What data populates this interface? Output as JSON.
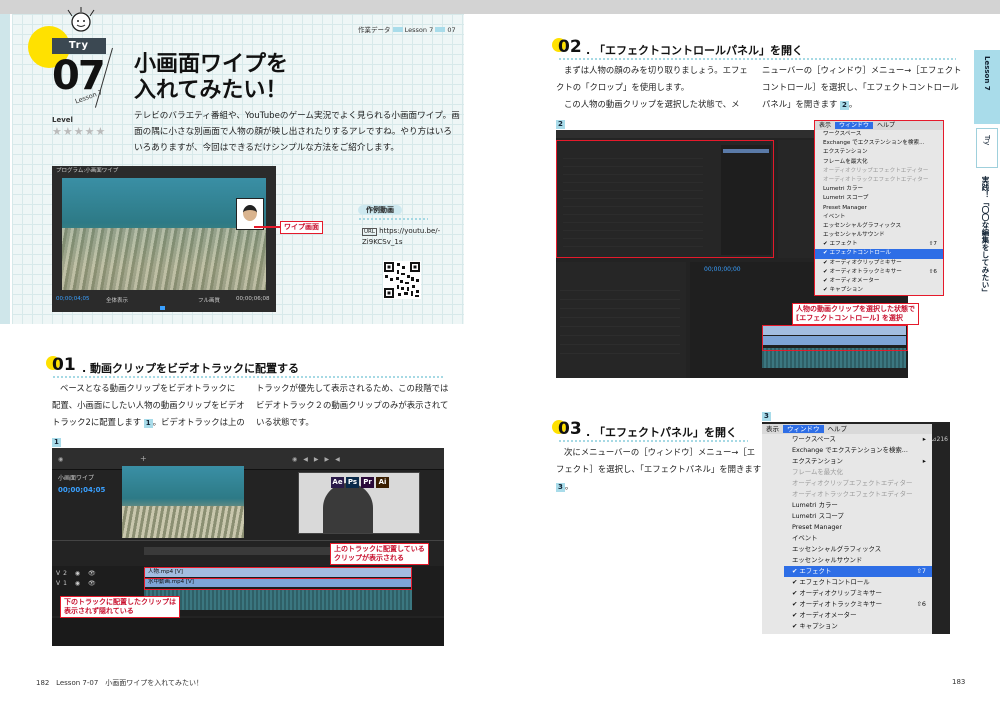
{
  "header": {
    "breadcrumb": [
      "作業データ",
      "Lesson 7",
      "07"
    ]
  },
  "lesson": {
    "try_label": "Try",
    "number": "07",
    "lesson_label": "Lesson 7",
    "title_line1": "小画面ワイプを",
    "title_line2": "入れてみたい！",
    "level_label": "Level",
    "level_stars": 5,
    "intro_lines": [
      "テレビのバラエティ番組や、YouTubeのゲーム実況でよく見られる小画面ワイプ。画",
      "面の隅に小さな別画面で人物の顔が映し出されたりするアレですね。やり方はいろ",
      "いろありますが、今回はできるだけシンプルな方法をご紹介します。"
    ]
  },
  "program_monitor": {
    "title": "プログラム:小画面ワイプ",
    "timecode_left": "00;00;04;05",
    "fit": "全体表示",
    "quality": "フル画質",
    "timecode_right": "00;00;06;08",
    "wipe_label": "ワイプ画面"
  },
  "video_link": {
    "heading": "作例動画",
    "url_tag": "URL",
    "url_line1": "https://youtu.be/-",
    "url_line2": "Zi9KCSv_1s"
  },
  "step01": {
    "num": "01",
    "title": "動画クリップをビデオトラックに配置する",
    "col1": [
      "ベースとなる動画クリップをビデオトラックに",
      "配置、小画面にしたい人物の動画クリップをビデオ",
      "トラック2に配置します",
      "。ビデオトラックは上の"
    ],
    "badge": "1",
    "col2": [
      "トラックが優先して表示されるため、この段階では",
      "ビデオトラック２の動画クリップのみが表示されて",
      "いる状態です。"
    ],
    "figure_badge": "1",
    "timeline_tab": "小画面ワイプ",
    "timeline_tc": "00;00;04;05",
    "clip_upper": "人物.mp4 [V]",
    "clip_lower": "水中動画.mp4 [V]",
    "note_upper": [
      "上のトラックに配置している",
      "クリップが表示される"
    ],
    "note_lower": [
      "下のトラックに配置したクリップは",
      "表示されず隠れている"
    ],
    "brand_tiles": [
      "Ae",
      "Ps",
      "Pr",
      "Ai"
    ]
  },
  "step02": {
    "num": "02",
    "title": "「エフェクトコントロールパネル」を開く",
    "col1": [
      "まずは人物の顔のみを切り取りましょう。エフェ",
      "クトの「クロップ」を使用します。",
      "この人物の動画クリップを選択した状態で、メ"
    ],
    "col2": [
      "ニューバーの［ウィンドウ］メニュー→［エフェクト",
      "コントロール］を選択し、「エフェクトコントロール",
      "パネル」を開きます"
    ],
    "badge": "2",
    "figure_badge": "2",
    "menu_bar": [
      "表示",
      "ウィンドウ",
      "ヘルプ"
    ],
    "menu_items": [
      {
        "label": "ワークスペース",
        "state": "normal",
        "shortcut": ""
      },
      {
        "label": "Exchange でエクステンションを検索...",
        "state": "normal",
        "shortcut": ""
      },
      {
        "label": "エクステンション",
        "state": "normal",
        "shortcut": ""
      },
      {
        "label": "フレームを最大化",
        "state": "normal",
        "shortcut": ""
      },
      {
        "label": "オーディオクリップエフェクトエディター",
        "state": "dis",
        "shortcut": ""
      },
      {
        "label": "オーディオトラックエフェクトエディター",
        "state": "dis",
        "shortcut": ""
      },
      {
        "label": "Lumetri カラー",
        "state": "normal",
        "shortcut": ""
      },
      {
        "label": "Lumetri スコープ",
        "state": "normal",
        "shortcut": ""
      },
      {
        "label": "Preset Manager",
        "state": "normal",
        "shortcut": ""
      },
      {
        "label": "イベント",
        "state": "normal",
        "shortcut": ""
      },
      {
        "label": "エッセンシャルグラフィックス",
        "state": "normal",
        "shortcut": ""
      },
      {
        "label": "エッセンシャルサウンド",
        "state": "normal",
        "shortcut": ""
      },
      {
        "label": "✔ エフェクト",
        "state": "normal",
        "shortcut": "⇧7"
      },
      {
        "label": "✔ エフェクトコントロール",
        "state": "sel",
        "shortcut": ""
      },
      {
        "label": "✔ オーディオクリップミキサー",
        "state": "normal",
        "shortcut": ""
      },
      {
        "label": "✔ オーディオトラックミキサー",
        "state": "normal",
        "shortcut": "⇧6"
      },
      {
        "label": "✔ オーディオメーター",
        "state": "normal",
        "shortcut": ""
      },
      {
        "label": "✔ キャプション",
        "state": "normal",
        "shortcut": ""
      }
    ],
    "note": [
      "人物の動画クリップを選択した状態で",
      "[エフェクトコントロール] を選択"
    ]
  },
  "step03": {
    "num": "03",
    "title": "「エフェクトパネル」を開く",
    "lines": [
      "次にメニューバーの［ウィンドウ］メニュー→［エ",
      "フェクト］を選択し、「エフェクトパネル」を開きます"
    ],
    "badge": "3",
    "figure_badge": "3",
    "menu_bar": [
      "表示",
      "ウィンドウ",
      "ヘルプ"
    ],
    "menu_items": [
      {
        "label": "ワークスペース",
        "state": "normal",
        "shortcut": "▸"
      },
      {
        "label": "Exchange でエクステンションを検索...",
        "state": "normal",
        "shortcut": ""
      },
      {
        "label": "エクステンション",
        "state": "normal",
        "shortcut": "▸"
      },
      {
        "label": "フレームを最大化",
        "state": "dis",
        "shortcut": ""
      },
      {
        "label": "オーディオクリップエフェクトエディター",
        "state": "dis",
        "shortcut": ""
      },
      {
        "label": "オーディオトラックエフェクトエディター",
        "state": "dis",
        "shortcut": ""
      },
      {
        "label": "Lumetri カラー",
        "state": "normal",
        "shortcut": ""
      },
      {
        "label": "Lumetri スコープ",
        "state": "normal",
        "shortcut": ""
      },
      {
        "label": "Preset Manager",
        "state": "normal",
        "shortcut": ""
      },
      {
        "label": "イベント",
        "state": "normal",
        "shortcut": ""
      },
      {
        "label": "エッセンシャルグラフィックス",
        "state": "normal",
        "shortcut": ""
      },
      {
        "label": "エッセンシャルサウンド",
        "state": "normal",
        "shortcut": ""
      },
      {
        "label": "✔ エフェクト",
        "state": "sel",
        "shortcut": "⇧7"
      },
      {
        "label": "✔ エフェクトコントロール",
        "state": "normal",
        "shortcut": ""
      },
      {
        "label": "✔ オーディオクリップミキサー",
        "state": "normal",
        "shortcut": ""
      },
      {
        "label": "✔ オーディオトラックミキサー",
        "state": "normal",
        "shortcut": "⇧6"
      },
      {
        "label": "✔ オーディオメーター",
        "state": "normal",
        "shortcut": ""
      },
      {
        "label": "✔ キャプション",
        "state": "normal",
        "shortcut": ""
      }
    ],
    "right_fragment": [
      "⊿216"
    ]
  },
  "sidebar": {
    "lesson": "Lesson 7",
    "try": "Try",
    "chapter": "実践！「〇〇な編集をしてみたい」"
  },
  "footer": {
    "left_page": "182",
    "left_text": "Lesson 7-07　小画面ワイプを入れてみたい！",
    "right_page": "183"
  },
  "colors": {
    "accent_yellow": "#ffe100",
    "accent_cyan": "#a9dcea",
    "note_red": "#e51a2b",
    "menu_highlight": "#2e6ee6"
  }
}
